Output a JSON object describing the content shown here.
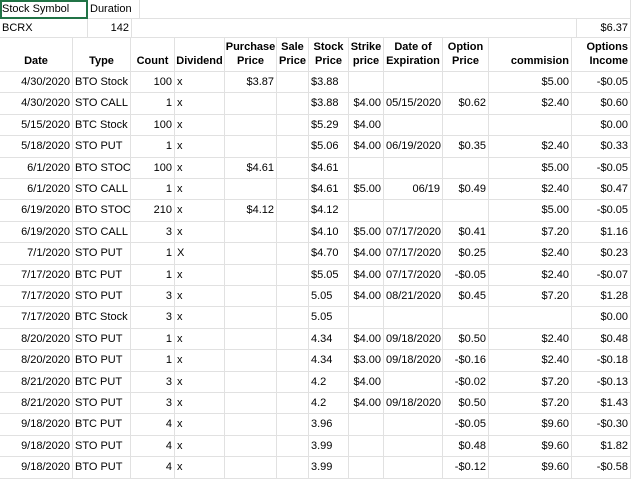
{
  "top": {
    "a1": "Stock Symbol",
    "b1": "Duration",
    "a2": "BCRX",
    "b2": "142",
    "total": "$6.37"
  },
  "headers": [
    "Date",
    "Type",
    "Count",
    "Dividend",
    "Purchase Price",
    "Sale Price",
    "Stock Price",
    "Strike price",
    "Date of Expiration",
    "Option Price",
    "commision",
    "Options Income"
  ],
  "rows": [
    [
      "4/30/2020",
      "BTO Stock",
      "100",
      "x",
      "$3.87",
      "",
      "$3.88",
      "",
      "",
      "",
      "$5.00",
      "-$0.05"
    ],
    [
      "4/30/2020",
      "STO CALL",
      "1",
      "x",
      "",
      "",
      "$3.88",
      "$4.00",
      "05/15/2020",
      "$0.62",
      "$2.40",
      "$0.60"
    ],
    [
      "5/15/2020",
      "BTC Stock",
      "100",
      "x",
      "",
      "",
      "$5.29",
      "$4.00",
      "",
      "",
      "",
      "$0.00"
    ],
    [
      "5/18/2020",
      "STO PUT",
      "1",
      "x",
      "",
      "",
      "$5.06",
      "$4.00",
      "06/19/2020",
      "$0.35",
      "$2.40",
      "$0.33"
    ],
    [
      "6/1/2020",
      "BTO STOCK",
      "100",
      "x",
      "$4.61",
      "",
      "$4.61",
      "",
      "",
      "",
      "$5.00",
      "-$0.05"
    ],
    [
      "6/1/2020",
      "STO CALL",
      "1",
      "x",
      "",
      "",
      "$4.61",
      "$5.00",
      "06/19",
      "$0.49",
      "$2.40",
      "$0.47"
    ],
    [
      "6/19/2020",
      "BTO STOCK",
      "210",
      "x",
      "$4.12",
      "",
      "$4.12",
      "",
      "",
      "",
      "$5.00",
      "-$0.05"
    ],
    [
      "6/19/2020",
      "STO CALL",
      "3",
      "x",
      "",
      "",
      "$4.10",
      "$5.00",
      "07/17/2020",
      "$0.41",
      "$7.20",
      "$1.16"
    ],
    [
      "7/1/2020",
      "STO PUT",
      "1",
      "X",
      "",
      "",
      "$4.70",
      "$4.00",
      "07/17/2020",
      "$0.25",
      "$2.40",
      "$0.23"
    ],
    [
      "7/17/2020",
      "BTC PUT",
      "1",
      "x",
      "",
      "",
      "$5.05",
      "$4.00",
      "07/17/2020",
      "-$0.05",
      "$2.40",
      "-$0.07"
    ],
    [
      "7/17/2020",
      "STO PUT",
      "3",
      "x",
      "",
      "",
      "5.05",
      "$4.00",
      "08/21/2020",
      "$0.45",
      "$7.20",
      "$1.28"
    ],
    [
      "7/17/2020",
      "BTC Stock",
      "3",
      "x",
      "",
      "",
      "5.05",
      "",
      "",
      "",
      "",
      "$0.00"
    ],
    [
      "8/20/2020",
      "STO PUT",
      "1",
      "x",
      "",
      "",
      "4.34",
      "$4.00",
      "09/18/2020",
      "$0.50",
      "$2.40",
      "$0.48"
    ],
    [
      "8/20/2020",
      "BTO PUT",
      "1",
      "x",
      "",
      "",
      "4.34",
      "$3.00",
      "09/18/2020",
      "-$0.16",
      "$2.40",
      "-$0.18"
    ],
    [
      "8/21/2020",
      "BTC PUT",
      "3",
      "x",
      "",
      "",
      "4.2",
      "$4.00",
      "",
      "-$0.02",
      "$7.20",
      "-$0.13"
    ],
    [
      "8/21/2020",
      "STO PUT",
      "3",
      "x",
      "",
      "",
      "4.2",
      "$4.00",
      "09/18/2020",
      "$0.50",
      "$7.20",
      "$1.43"
    ],
    [
      "9/18/2020",
      "BTC PUT",
      "4",
      "x",
      "",
      "",
      "3.96",
      "",
      "",
      "-$0.05",
      "$9.60",
      "-$0.30"
    ],
    [
      "9/18/2020",
      "STO PUT",
      "4",
      "x",
      "",
      "",
      "3.99",
      "",
      "",
      "$0.48",
      "$9.60",
      "$1.82"
    ],
    [
      "9/18/2020",
      "BTO PUT",
      "4",
      "x",
      "",
      "",
      "3.99",
      "",
      "",
      "-$0.12",
      "$9.60",
      "-$0.58"
    ]
  ]
}
